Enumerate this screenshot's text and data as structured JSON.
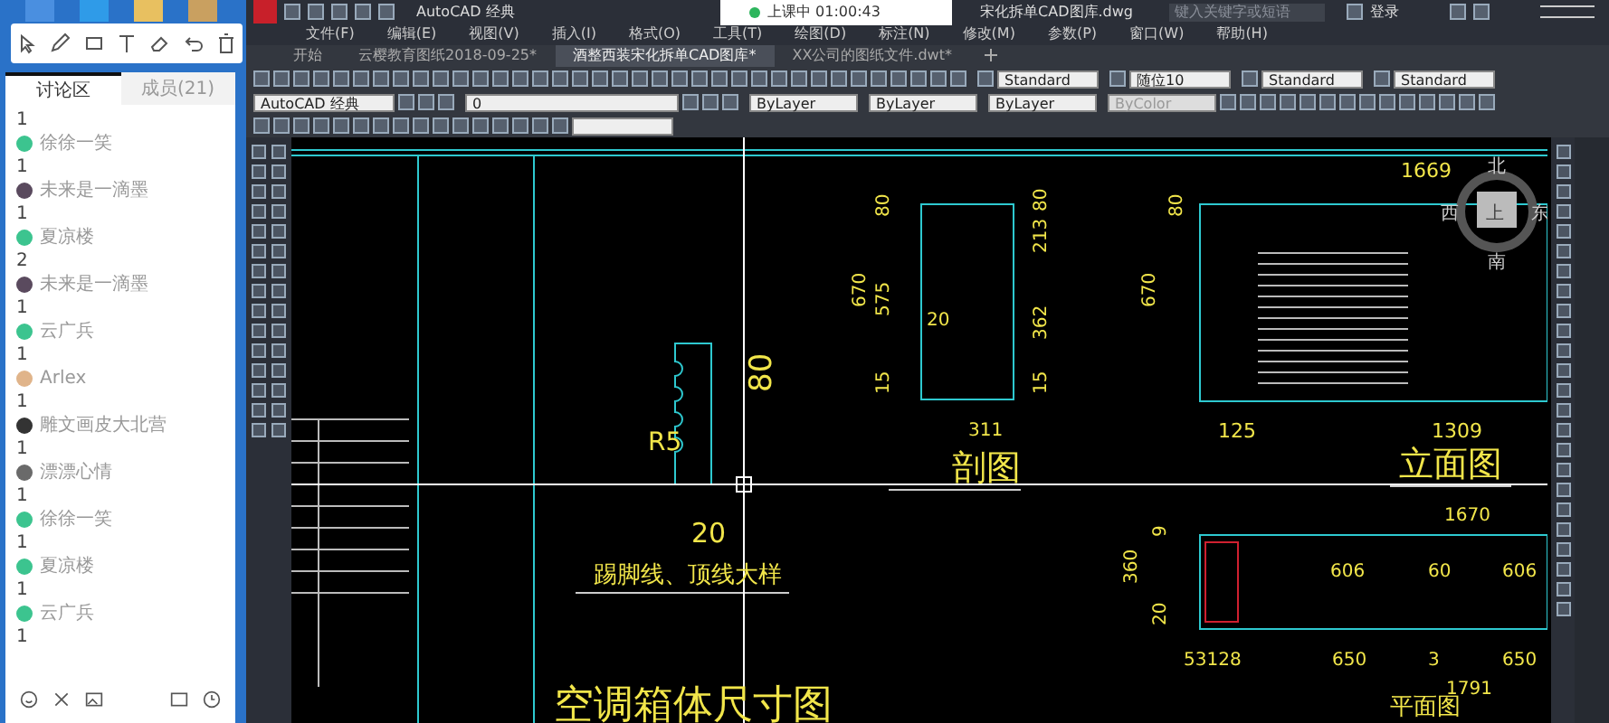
{
  "chat_panel": {
    "tabs": [
      {
        "label": "讨论区",
        "selected": true
      },
      {
        "label": "成员(21)",
        "selected": false
      }
    ],
    "feed": [
      {
        "kind": "count",
        "text": "1"
      },
      {
        "kind": "user",
        "name": "徐徐一笑",
        "color": "#3cc48f"
      },
      {
        "kind": "count",
        "text": "1"
      },
      {
        "kind": "user",
        "name": "未来是一滴墨",
        "color": "#5a4a5e"
      },
      {
        "kind": "count",
        "text": "1"
      },
      {
        "kind": "user",
        "name": "夏凉楼",
        "color": "#3cc48f"
      },
      {
        "kind": "count",
        "text": "2"
      },
      {
        "kind": "user",
        "name": "未来是一滴墨",
        "color": "#5a4a5e"
      },
      {
        "kind": "count",
        "text": "1"
      },
      {
        "kind": "user",
        "name": "云广兵",
        "color": "#3cc48f"
      },
      {
        "kind": "count",
        "text": "1"
      },
      {
        "kind": "user",
        "name": "Arlex",
        "color": "#e0b48a"
      },
      {
        "kind": "count",
        "text": "1"
      },
      {
        "kind": "user",
        "name": "雕文画皮大北营",
        "color": "#333333"
      },
      {
        "kind": "count",
        "text": "1"
      },
      {
        "kind": "user",
        "name": "漂漂心情",
        "color": "#6a6a6a"
      },
      {
        "kind": "count",
        "text": "1"
      },
      {
        "kind": "user",
        "name": "徐徐一笑",
        "color": "#3cc48f"
      },
      {
        "kind": "count",
        "text": "1"
      },
      {
        "kind": "user",
        "name": "夏凉楼",
        "color": "#3cc48f"
      },
      {
        "kind": "count",
        "text": "1"
      },
      {
        "kind": "user",
        "name": "云广兵",
        "color": "#3cc48f"
      },
      {
        "kind": "count",
        "text": "1"
      }
    ]
  },
  "class_timer": {
    "text": "上课中 01:00:43"
  },
  "cad": {
    "workspace": "AutoCAD 经典",
    "title": "宋化拆单CAD图库.dwg",
    "search": {
      "placeholder": "键入关键字或短语"
    },
    "login": "登录",
    "menu": [
      "文件(F)",
      "编辑(E)",
      "视图(V)",
      "插入(I)",
      "格式(O)",
      "工具(T)",
      "绘图(D)",
      "标注(N)",
      "修改(M)",
      "参数(P)",
      "窗口(W)",
      "帮助(H)"
    ],
    "doc_tabs": [
      {
        "label": "开始",
        "selected": false
      },
      {
        "label": "云樱教育图纸2018-09-25*",
        "selected": false
      },
      {
        "label": "酒整西装宋化拆单CAD图库*",
        "selected": true
      },
      {
        "label": "XX公司的图纸文件.dwt*",
        "selected": false
      }
    ],
    "style_dropdowns": [
      "Standard",
      "随位10",
      "Standard",
      "Standard"
    ],
    "workspace_dropdown": "AutoCAD 经典",
    "layer": "0",
    "property_dropdowns": [
      {
        "text": "ByLayer",
        "disabled": false
      },
      {
        "text": "ByLayer",
        "disabled": false
      },
      {
        "text": "ByLayer",
        "disabled": false
      },
      {
        "text": "ByColor",
        "disabled": true
      }
    ],
    "drawing": {
      "labels": [
        "80",
        "R5",
        "20",
        "踢脚线、顶线大样",
        "80",
        "670",
        "575",
        "20",
        "15",
        "80",
        "213",
        "362",
        "15",
        "311",
        "剖图",
        "1669",
        "80",
        "670",
        "125",
        "1309",
        "立面图",
        "1670",
        "9",
        "360",
        "606",
        "60",
        "606",
        "20",
        "53128",
        "650",
        "3",
        "650",
        "空调箱体尺寸图",
        "1791",
        "平面图"
      ],
      "compass": [
        "北",
        "西",
        "上",
        "东",
        "南"
      ]
    }
  }
}
